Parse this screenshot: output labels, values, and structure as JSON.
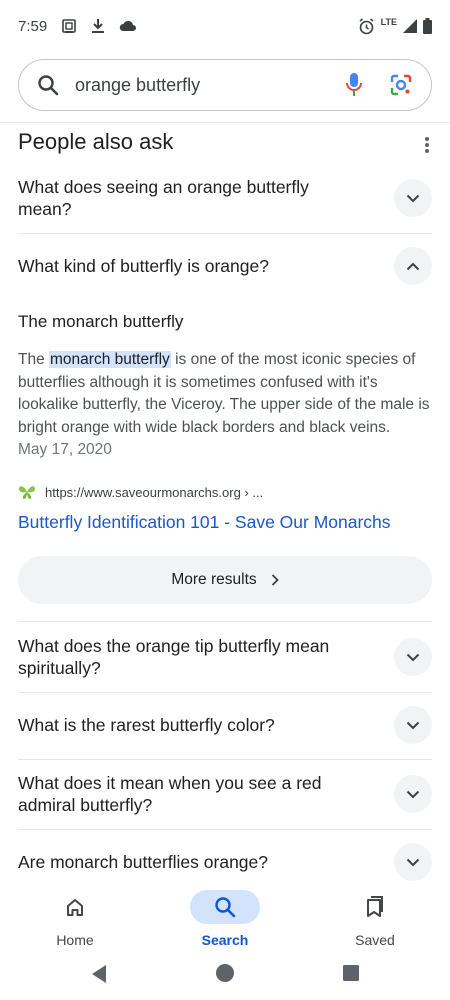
{
  "status_bar": {
    "time": "7:59",
    "network_label": "LTE",
    "icons": [
      "screenshot-icon",
      "download-icon",
      "cloud-icon",
      "alarm-icon",
      "signal-icon",
      "battery-icon"
    ]
  },
  "search": {
    "query": "orange butterfly",
    "icons": [
      "search-icon",
      "mic-icon",
      "lens-icon"
    ]
  },
  "paa": {
    "title": "People also ask",
    "questions": [
      {
        "text": "What does seeing an orange butterfly mean?",
        "expanded": false
      },
      {
        "text": "What kind of butterfly is orange?",
        "expanded": true
      },
      {
        "text": "What does the orange tip butterfly mean spiritually?",
        "expanded": false
      },
      {
        "text": "What is the rarest butterfly color?",
        "expanded": false
      },
      {
        "text": "What does it mean when you see a red admiral butterfly?",
        "expanded": false
      },
      {
        "text": "Are monarch butterflies orange?",
        "expanded": false
      }
    ],
    "answer": {
      "heading": "The monarch butterfly",
      "body_before": "The ",
      "highlight": "monarch butterfly",
      "body_after": " is one of the most iconic species of butterflies although it is sometimes confused with it's lookalike butterfly, the Viceroy. The upper side of the male is bright orange with wide black borders and black veins.",
      "date": "May 17, 2020",
      "source_url": "https://www.saveourmonarchs.org › ...",
      "link_title": "Butterfly Identification 101 - Save Our Monarchs"
    },
    "more_results_label": "More results"
  },
  "bottom_nav": {
    "items": [
      {
        "label": "Home",
        "icon": "home-icon",
        "active": false
      },
      {
        "label": "Search",
        "icon": "search-icon",
        "active": true
      },
      {
        "label": "Saved",
        "icon": "bookmarks-icon",
        "active": false
      }
    ]
  },
  "system_nav": {
    "icons": [
      "back-icon",
      "home-circle-icon",
      "recents-icon"
    ]
  },
  "colors": {
    "link_blue": "#1a57c8",
    "active_nav": "#0b57d0",
    "highlight": "#d3e3fd",
    "chip_gray": "#f1f3f4"
  }
}
